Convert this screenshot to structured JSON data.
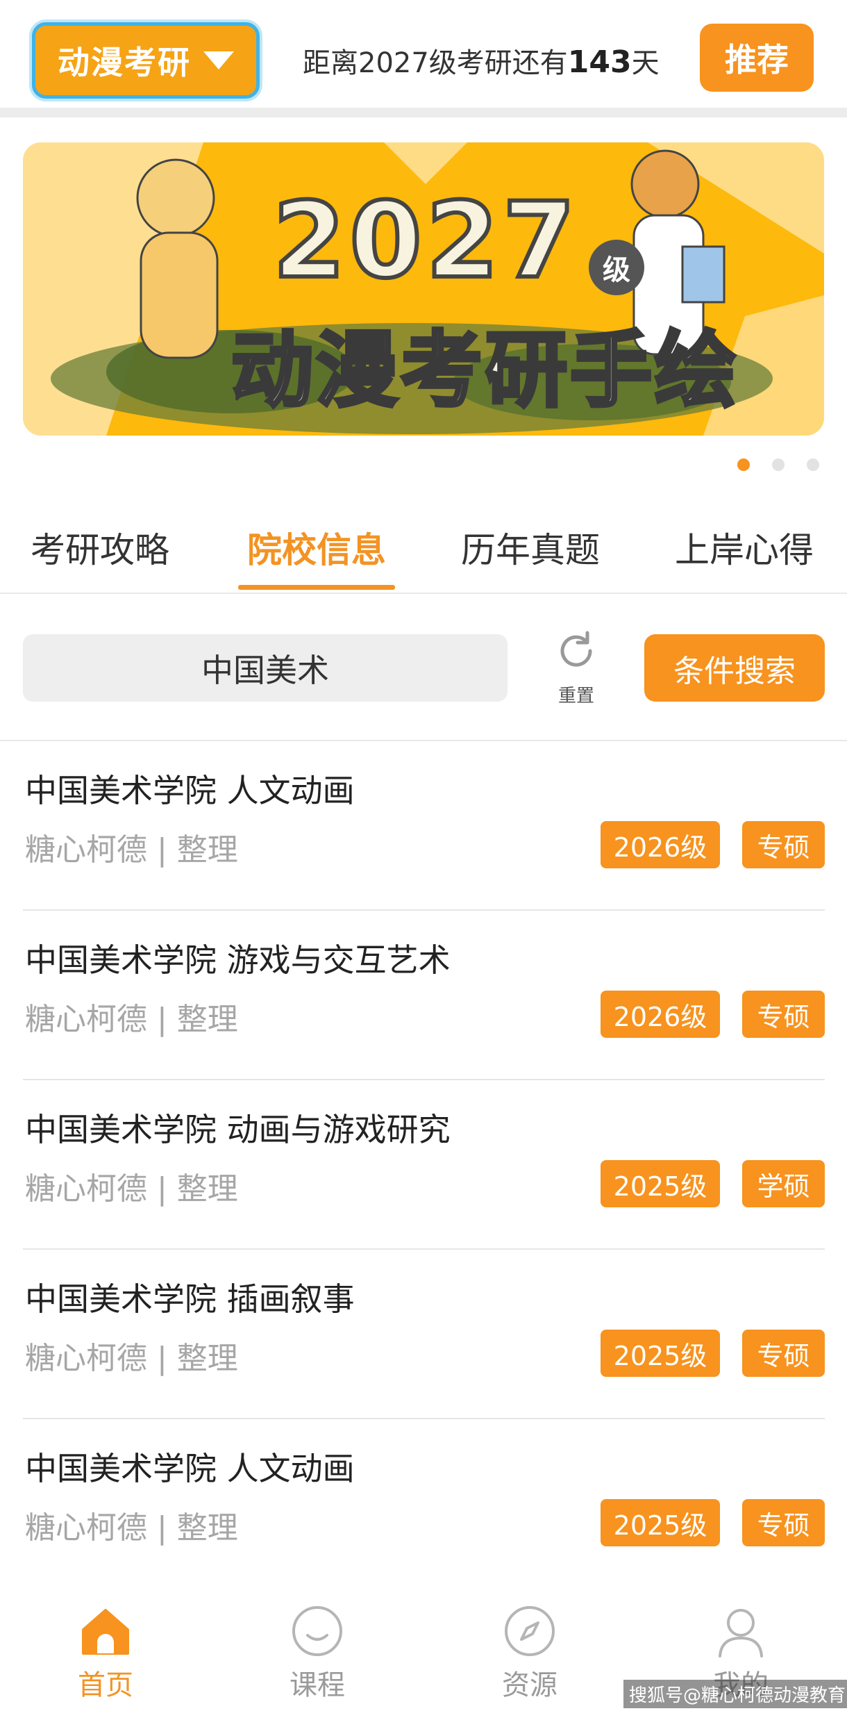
{
  "header": {
    "brand": "动漫考研",
    "countdown_prefix": "距离2027级考研还有",
    "countdown_days": "143",
    "countdown_suffix": "天",
    "recommend_label": "推荐"
  },
  "banner": {
    "year": "2027",
    "grade": "级",
    "title": "动漫考研手绘",
    "slide_count": 3,
    "active_slide": 1
  },
  "tabs": [
    {
      "label": "考研攻略",
      "active": false
    },
    {
      "label": "院校信息",
      "active": true
    },
    {
      "label": "历年真题",
      "active": false
    },
    {
      "label": "上岸心得",
      "active": false
    }
  ],
  "search": {
    "value": "中国美术",
    "reset_label": "重置",
    "button_label": "条件搜索"
  },
  "list": [
    {
      "title": "中国美术学院 人文动画",
      "meta": "糖心柯德 | 整理",
      "year": "2026级",
      "type": "专硕"
    },
    {
      "title": "中国美术学院 游戏与交互艺术",
      "meta": "糖心柯德 | 整理",
      "year": "2026级",
      "type": "专硕"
    },
    {
      "title": "中国美术学院 动画与游戏研究",
      "meta": "糖心柯德 | 整理",
      "year": "2025级",
      "type": "学硕"
    },
    {
      "title": "中国美术学院 插画叙事",
      "meta": "糖心柯德 | 整理",
      "year": "2025级",
      "type": "专硕"
    },
    {
      "title": "中国美术学院 人文动画",
      "meta": "糖心柯德 | 整理",
      "year": "2025级",
      "type": "专硕"
    }
  ],
  "bottom_nav": [
    {
      "label": "首页",
      "icon": "home-icon",
      "active": true
    },
    {
      "label": "课程",
      "icon": "smile-icon",
      "active": false
    },
    {
      "label": "资源",
      "icon": "compass-icon",
      "active": false
    },
    {
      "label": "我的",
      "icon": "user-icon",
      "active": false
    }
  ],
  "watermark": "搜狐号@糖心柯德动漫教育",
  "colors": {
    "accent": "#f7931e",
    "tab_active": "#f39323",
    "brand_border": "#3fb3e8",
    "banner_bg": "#fdb90c",
    "meta_text": "#a6a6a6"
  }
}
